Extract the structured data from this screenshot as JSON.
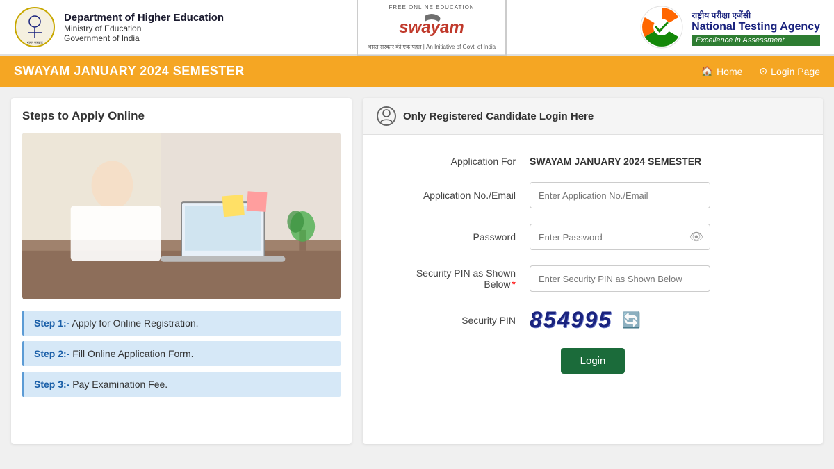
{
  "header": {
    "dept_name": "Department of Higher Education",
    "ministry": "Ministry of Education",
    "govt": "Government of India",
    "swayam_free": "FREE ONLINE EDUCATION",
    "swayam_name": "swayam",
    "swayam_sub": "भारत सरकार की एक पहल | An Initiative of Govt. of India",
    "nta_hindi": "राष्ट्रीय परीक्षा एजेंसी",
    "nta_english": "National Testing Agency",
    "nta_tagline": "Excellence in Assessment"
  },
  "navbar": {
    "title": "SWAYAM JANUARY 2024 SEMESTER",
    "home_label": "Home",
    "login_label": "Login Page"
  },
  "left_panel": {
    "title": "Steps to Apply Online",
    "steps": [
      {
        "bold": "Step 1:-",
        "text": " Apply for Online Registration."
      },
      {
        "bold": "Step 2:-",
        "text": " Fill Online Application Form."
      },
      {
        "bold": "Step 3:-",
        "text": " Pay Examination Fee."
      }
    ]
  },
  "right_panel": {
    "header_title": "Only Registered Candidate Login Here",
    "application_for_label": "Application For",
    "application_for_value": "SWAYAM JANUARY 2024 SEMESTER",
    "app_no_label": "Application No./Email",
    "app_no_placeholder": "Enter Application No./Email",
    "password_label": "Password",
    "password_placeholder": "Enter Password",
    "security_pin_label": "Security PIN as Shown Below",
    "security_pin_placeholder": "Enter Security PIN as Shown Below",
    "security_pin_display_label": "Security PIN",
    "security_pin_value": "854995",
    "login_button": "Login"
  }
}
